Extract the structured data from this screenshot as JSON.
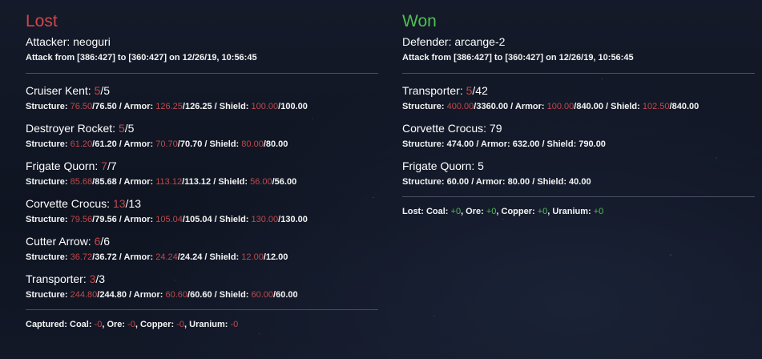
{
  "left": {
    "status": "Lost",
    "party": "Attacker: neoguri",
    "attack_line": "Attack from [386:427] to [360:427] on 12/26/19, 10:56:45",
    "ships": [
      {
        "name": "Cruiser Kent: ",
        "count": "5",
        "total": "/5",
        "structure": "76.50",
        "structure_max": "/76.50",
        "armor": "126.25",
        "armor_max": "/126.25",
        "shield": "100.00",
        "shield_max": "/100.00"
      },
      {
        "name": "Destroyer Rocket: ",
        "count": "5",
        "total": "/5",
        "structure": "61.20",
        "structure_max": "/61.20",
        "armor": "70.70",
        "armor_max": "/70.70",
        "shield": "80.00",
        "shield_max": "/80.00"
      },
      {
        "name": "Frigate Quorn: ",
        "count": "7",
        "total": "/7",
        "structure": "85.68",
        "structure_max": "/85.68",
        "armor": "113.12",
        "armor_max": "/113.12",
        "shield": "56.00",
        "shield_max": "/56.00"
      },
      {
        "name": "Corvette Crocus: ",
        "count": "13",
        "total": "/13",
        "structure": "79.56",
        "structure_max": "/79.56",
        "armor": "105.04",
        "armor_max": "/105.04",
        "shield": "130.00",
        "shield_max": "/130.00"
      },
      {
        "name": "Cutter Arrow: ",
        "count": "6",
        "total": "/6",
        "structure": "36.72",
        "structure_max": "/36.72",
        "armor": "24.24",
        "armor_max": "/24.24",
        "shield": "12.00",
        "shield_max": "/12.00"
      },
      {
        "name": "Transporter: ",
        "count": "3",
        "total": "/3",
        "structure": "244.80",
        "structure_max": "/244.80",
        "armor": "60.60",
        "armor_max": "/60.60",
        "shield": "60.00",
        "shield_max": "/60.00"
      }
    ],
    "loot": {
      "label": "Captured: ",
      "coal_label": "Coal: ",
      "coal": "-0",
      "ore_label": ", Ore: ",
      "ore": "-0",
      "copper_label": ", Copper: ",
      "copper": "-0",
      "uranium_label": ", Uranium: ",
      "uranium": "-0"
    }
  },
  "right": {
    "status": "Won",
    "party": "Defender: arcange-2",
    "attack_line": "Attack from [386:427] to [360:427] on 12/26/19, 10:56:45",
    "ships": [
      {
        "name": "Transporter: ",
        "count": "5",
        "total": "/42",
        "structure": "400.00",
        "structure_max": "/3360.00",
        "armor": "100.00",
        "armor_max": "/840.00",
        "shield": "102.50",
        "shield_max": "/840.00"
      },
      {
        "name": "Corvette Crocus: 79",
        "stats": "Structure: 474.00 / Armor: 632.00 / Shield: 790.00"
      },
      {
        "name": "Frigate Quorn: 5",
        "stats": "Structure: 60.00 / Armor: 80.00 / Shield: 40.00"
      }
    ],
    "loot": {
      "label": "Lost: ",
      "coal_label": "Coal: ",
      "coal": "+0",
      "ore_label": ", Ore: ",
      "ore": "+0",
      "copper_label": ", Copper: ",
      "copper": "+0",
      "uranium_label": ", Uranium: ",
      "uranium": "+0"
    }
  },
  "labels": {
    "structure": "Structure: ",
    "armor": " / Armor: ",
    "shield": " / Shield: "
  },
  "colors": {
    "lost": "#d0474a",
    "won": "#4fbf52",
    "damage": "#c0494b",
    "gain": "#4fbf52"
  }
}
